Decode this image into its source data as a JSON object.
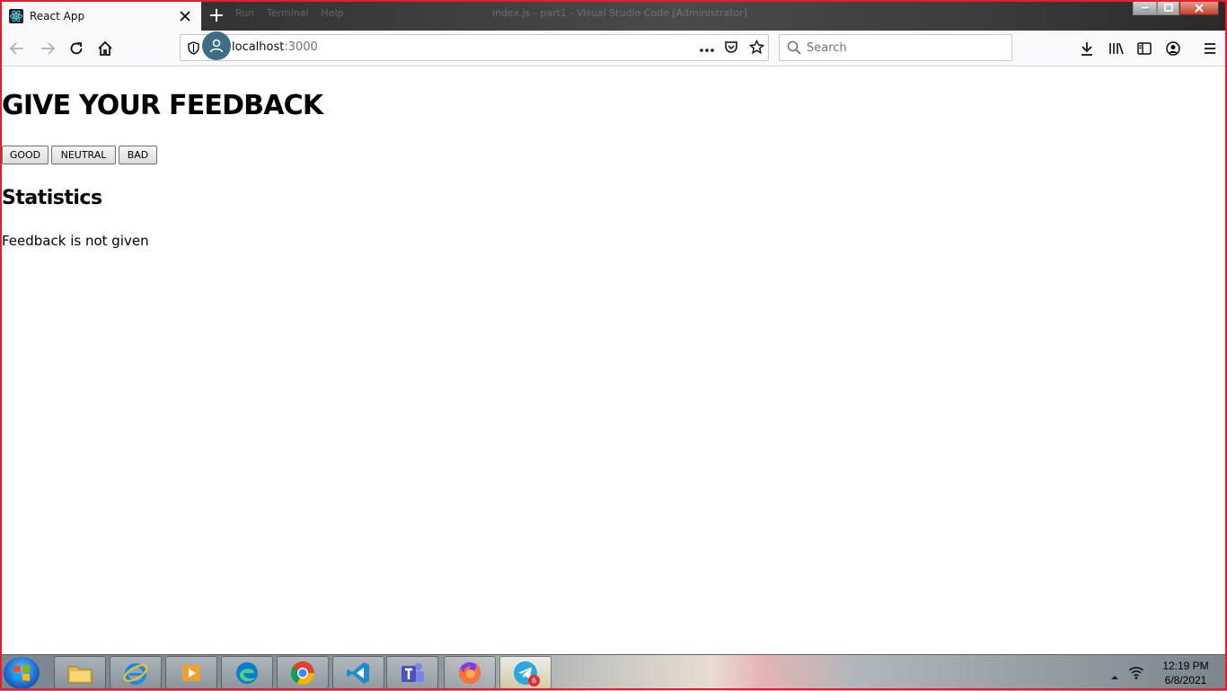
{
  "browser": {
    "tab": {
      "title": "React App",
      "favicon": "react-icon"
    },
    "background_window_title": "...",
    "url": {
      "host": "localhost",
      "port": ":3000"
    },
    "search_placeholder": "Search"
  },
  "page": {
    "title": "GIVE YOUR FEEDBACK",
    "buttons": [
      "GOOD",
      "NEUTRAL",
      "BAD"
    ],
    "statistics_heading": "Statistics",
    "statistics_text": "Feedback is not given"
  },
  "taskbar": {
    "apps": [
      "file-explorer-icon",
      "internet-explorer-icon",
      "media-player-icon",
      "edge-icon",
      "chrome-icon",
      "vscode-icon",
      "teams-icon",
      "firefox-icon",
      "telegram-icon"
    ],
    "telegram_badge": "6",
    "clock": {
      "time": "12:19 PM",
      "date": "6/8/2021"
    }
  },
  "colors": {
    "frame": "#e0202c",
    "avatar": "#3d6e86"
  }
}
